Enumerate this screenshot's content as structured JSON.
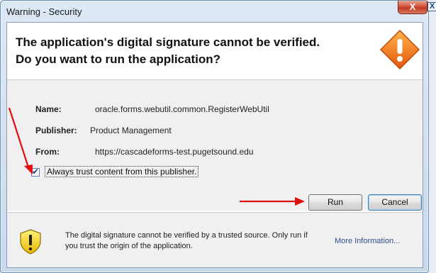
{
  "window": {
    "title": "Warning - Security",
    "close_glyph": "X"
  },
  "outer_close_glyph": "X",
  "header": {
    "line1": "The application's digital signature cannot be verified.",
    "line2": "Do you want to run the application?",
    "icon": "warning-icon"
  },
  "details": {
    "name_label": "Name:",
    "name_value": "oracle.forms.webutil.common.RegisterWebUtil",
    "publisher_label": "Publisher:",
    "publisher_value": "Product Management",
    "from_label": "From:",
    "from_value": "https://cascadeforms-test.pugetsound.edu"
  },
  "trust_checkbox": {
    "label": "Always trust content from this publisher.",
    "checked": true
  },
  "buttons": {
    "run": "Run",
    "cancel": "Cancel"
  },
  "footer": {
    "text": "The digital signature cannot be verified by a trusted source.  Only run if you trust the origin of the application.",
    "more_info": "More Information...",
    "icon": "shield-warning-icon"
  },
  "colors": {
    "accent_arrow": "#e01010",
    "warning_orange": "#f07a1a"
  }
}
